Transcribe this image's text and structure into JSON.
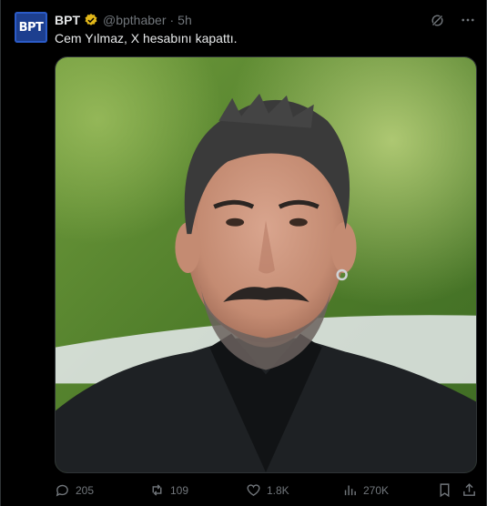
{
  "account": {
    "avatar_text": "BPT",
    "name": "BPT",
    "handle": "@bpthaber",
    "time": "5h"
  },
  "tweet": {
    "text": "Cem Yılmaz, X hesabını kapattı."
  },
  "stats": {
    "replies": "205",
    "retweets": "109",
    "likes": "1.8K",
    "views": "270K"
  },
  "icons": [
    "verified-badge-icon",
    "grok-icon",
    "more-icon",
    "reply-icon",
    "retweet-icon",
    "like-icon",
    "views-icon",
    "bookmark-icon",
    "share-icon"
  ],
  "colors": {
    "background": "#000000",
    "text": "#e7e9ea",
    "muted": "#71767b",
    "verified": "#e2b719",
    "avatar": "#1d3f8f"
  }
}
